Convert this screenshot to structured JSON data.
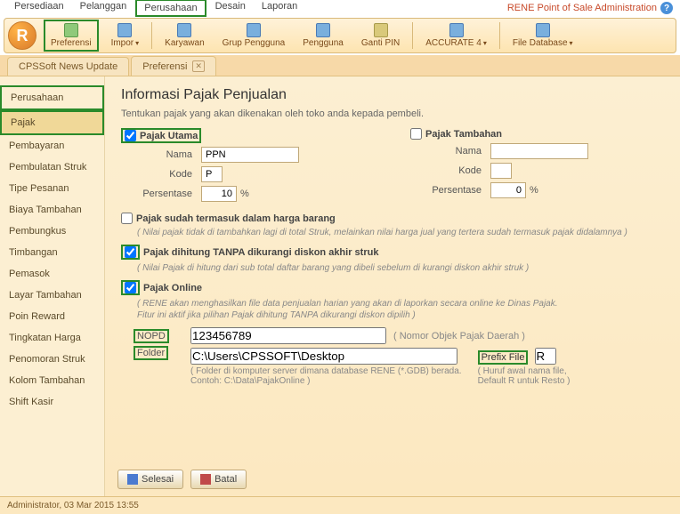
{
  "app": {
    "title": "RENE Point of Sale Administration"
  },
  "menu": {
    "items": [
      "Persediaan",
      "Pelanggan",
      "Perusahaan",
      "Desain",
      "Laporan"
    ]
  },
  "ribbon": {
    "buttons": [
      {
        "label": "Preferensi"
      },
      {
        "label": "Impor"
      },
      {
        "label": "Karyawan"
      },
      {
        "label": "Grup Pengguna"
      },
      {
        "label": "Pengguna"
      },
      {
        "label": "Ganti PIN"
      },
      {
        "label": "ACCURATE 4"
      },
      {
        "label": "File Database"
      }
    ]
  },
  "tabs": {
    "items": [
      "CPSSoft News Update",
      "Preferensi"
    ]
  },
  "sidebar": {
    "items": [
      "Perusahaan",
      "Pajak",
      "Pembayaran",
      "Pembulatan Struk",
      "Tipe Pesanan",
      "Biaya Tambahan",
      "Pembungkus",
      "Timbangan",
      "Pemasok",
      "Layar Tambahan",
      "Poin Reward",
      "Tingkatan Harga",
      "Penomoran Struk",
      "Kolom Tambahan",
      "Shift Kasir"
    ]
  },
  "page": {
    "title": "Informasi Pajak Penjualan",
    "desc": "Tentukan pajak yang akan dikenakan oleh toko anda kepada pembeli.",
    "pajak_utama": {
      "label": "Pajak Utama",
      "nama_label": "Nama",
      "nama_value": "PPN",
      "kode_label": "Kode",
      "kode_value": "P",
      "pct_label": "Persentase",
      "pct_value": "10",
      "pct_unit": "%"
    },
    "pajak_tambahan": {
      "label": "Pajak Tambahan",
      "nama_label": "Nama",
      "nama_value": "",
      "kode_label": "Kode",
      "kode_value": "",
      "pct_label": "Persentase",
      "pct_value": "0",
      "pct_unit": "%"
    },
    "sudah_termasuk": {
      "label": "Pajak sudah termasuk dalam harga barang",
      "note": "( Nilai pajak tidak di tambahkan lagi di total Struk, melainkan nilai  harga jual yang tertera sudah termasuk pajak didalamnya )"
    },
    "tanpa_diskon": {
      "label": "Pajak dihitung TANPA dikurangi diskon akhir struk",
      "note": "( Nilai Pajak di hitung dari sub total daftar barang yang dibeli sebelum di kurangi diskon akhir struk )"
    },
    "pajak_online": {
      "label": "Pajak Online",
      "note1": "( RENE akan menghasilkan file data penjualan harian yang akan di laporkan secara online ke Dinas Pajak.",
      "note2": "Fitur ini aktif jika pilihan Pajak dihitung TANPA dikurangi diskon dipilih )",
      "nopd_label": "NOPD",
      "nopd_value": "123456789",
      "nopd_hint": "( Nomor Objek Pajak Daerah )",
      "folder_label": "Folder",
      "folder_value": "C:\\Users\\CPSSOFT\\Desktop",
      "folder_note1": "( Folder di komputer server dimana database RENE (*.GDB) berada.",
      "folder_note2": "Contoh: C:\\Data\\PajakOnline )",
      "prefix_label": "Prefix File",
      "prefix_value": "R",
      "prefix_note1": "( Huruf awal nama file,",
      "prefix_note2": "Default R untuk Resto )"
    },
    "btn_save": "Selesai",
    "btn_cancel": "Batal"
  },
  "status": {
    "text": "Administrator, 03 Mar 2015  13:55"
  }
}
